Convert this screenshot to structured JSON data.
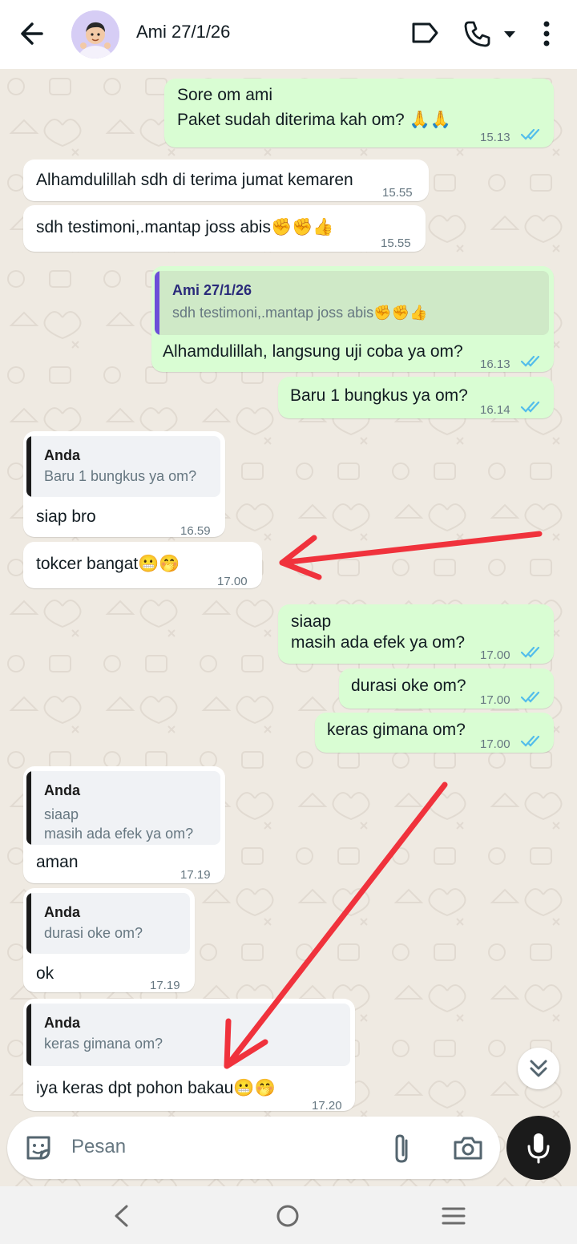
{
  "header": {
    "title": "Ami 27/1/26"
  },
  "messages": [
    {
      "dir": "out",
      "lines": [
        "Sore om ami",
        "Paket sudah diterima kah om?"
      ],
      "emoji": "🙏🙏",
      "time": "15.13"
    },
    {
      "dir": "in",
      "text": "Alhamdulillah sdh di terima jumat kemaren",
      "time": "15.55"
    },
    {
      "dir": "in",
      "text": "sdh testimoni,.mantap joss abis",
      "emoji": "✊✊👍",
      "time": "15.55"
    },
    {
      "dir": "out",
      "quote_name": "Ami 27/1/26",
      "quote_text": "sdh testimoni,.mantap joss abis",
      "quote_emoji": "✊✊👍",
      "text": "Alhamdulillah, langsung uji coba ya om?",
      "time": "16.13"
    },
    {
      "dir": "out",
      "text": "Baru 1 bungkus ya om?",
      "time": "16.14"
    },
    {
      "dir": "in",
      "quote_name": "Anda",
      "quote_text": "Baru 1 bungkus ya om?",
      "text": "siap bro",
      "time": "16.59"
    },
    {
      "dir": "in",
      "text": "tokcer bangat",
      "emoji": "😬🤭",
      "time": "17.00"
    },
    {
      "dir": "out",
      "lines": [
        "siaap",
        "masih ada efek ya om?"
      ],
      "time": "17.00"
    },
    {
      "dir": "out",
      "text": "durasi oke om?",
      "time": "17.00"
    },
    {
      "dir": "out",
      "text": "keras gimana om?",
      "time": "17.00"
    },
    {
      "dir": "in",
      "quote_name": "Anda",
      "quote_text": "siaap\nmasih ada efek ya om?",
      "text": "aman",
      "time": "17.19"
    },
    {
      "dir": "in",
      "quote_name": "Anda",
      "quote_text": "durasi oke om?",
      "text": "ok",
      "time": "17.19"
    },
    {
      "dir": "in",
      "quote_name": "Anda",
      "quote_text": "keras gimana om?",
      "text": "iya keras dpt pohon bakau",
      "emoji": "😬🤭",
      "time": "17.20"
    }
  ],
  "composer": {
    "placeholder": "Pesan"
  },
  "colors": {
    "header_bg": "#ffffff",
    "chat_bg": "#efeae2",
    "bubble_out": "#d9fdd3",
    "bubble_in": "#ffffff",
    "read_ticks": "#53bdeb",
    "quote_bar_in": "#1b1b1b",
    "quote_bar_out": "#6b4fd8",
    "annotation_arrow": "#f0323c"
  },
  "icons": {
    "back": "arrow-left-icon",
    "label": "label-tag-icon",
    "call": "phone-icon",
    "call_menu": "caret-down-icon",
    "menu": "more-vertical-icon",
    "sticker": "sticker-icon",
    "attach": "paperclip-icon",
    "camera": "camera-icon",
    "mic": "microphone-icon",
    "scroll": "double-chevron-down-icon"
  }
}
